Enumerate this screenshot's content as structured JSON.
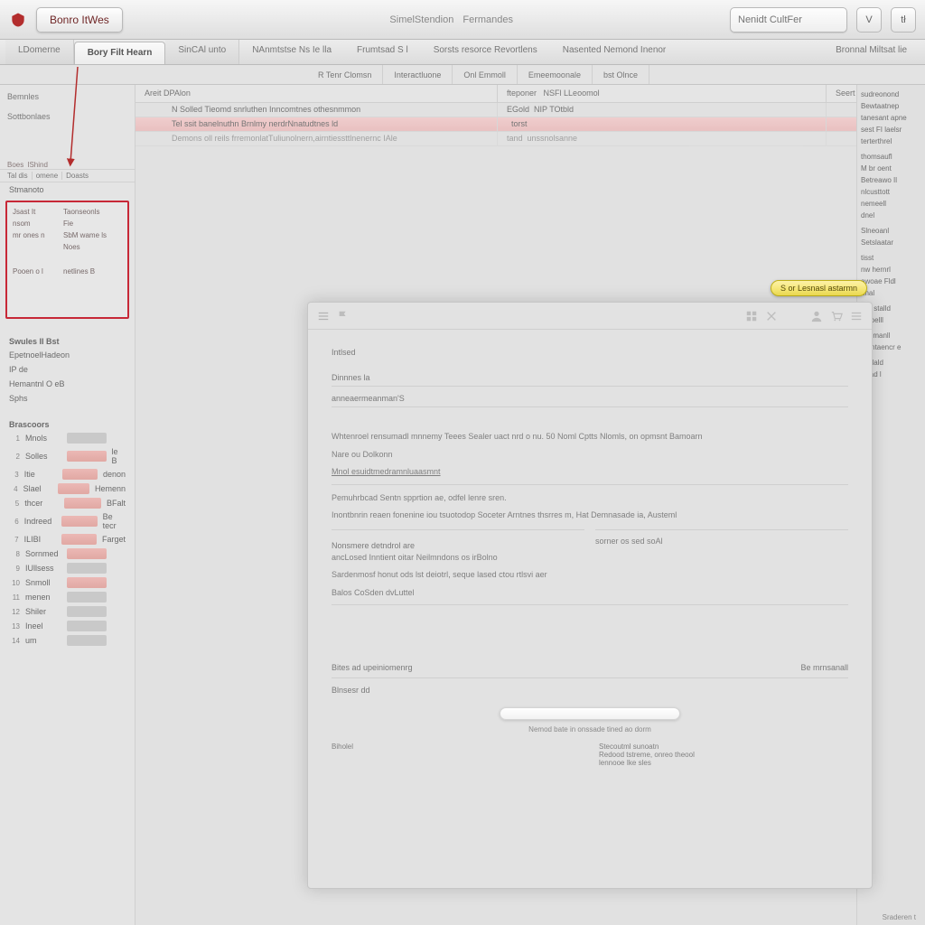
{
  "toolbar": {
    "main_button": "Bonro ItWes",
    "nav1": "SimelStendion",
    "nav2": "Fermandes",
    "search_placeholder": "Nenidt CultFer",
    "btn_v": "V",
    "btn_t": "tł"
  },
  "tabs": {
    "items": [
      {
        "label": "LDomerne"
      },
      {
        "label": "Bory Filt Hearn"
      },
      {
        "label": "SinCAl unto"
      },
      {
        "label": "NAnmtstse Ns Ie lla"
      },
      {
        "label": "Frumtsad S l"
      },
      {
        "label": "Sorsts resorce Revortlens"
      },
      {
        "label": "Nasented Nemond Inenor"
      }
    ],
    "far_label": "Bronnal Miltsat lie"
  },
  "subtabs": [
    "R Tenr Clomsn",
    "Interactluone",
    "Onl Emmoll",
    "Emeemoonale",
    "bst Olnce"
  ],
  "data_header": {
    "left": "Areit DPAlon",
    "mid": "fteponer",
    "mid2": "NSFl LLeoomol",
    "right": "Seert lut"
  },
  "data_rows": [
    {
      "left": "N Solled   Tieomd snrluthen Inncomtnes othesnmmon",
      "mid": "EGold",
      "mid2": "NIP TOtbld",
      "right": ""
    },
    {
      "left": "Tel   ssit banelnuthn Brnlmy nerdrNnatudtnes ld",
      "mid": "",
      "mid2": "torst",
      "right": "",
      "hl": true
    },
    {
      "left": "Demons oll   reils frremonlatTuliunolnern,airntiessttlnenernc IAle",
      "mid": "tand",
      "mid2": "unssnolsanne",
      "right": "",
      "muted": true
    }
  ],
  "sidebar_left": {
    "sec1": "Bemnles",
    "sec2": "Sottbonlaes",
    "arrow_labels": {
      "a": "Boes",
      "b": "IShind"
    },
    "crumb": {
      "a": "Tal dis",
      "b": "omene",
      "c": "Doasts"
    },
    "small_row": "Stmanoto",
    "red_box": {
      "rows": [
        [
          "Jsast It",
          "Taonseonls"
        ],
        [
          "nsom",
          "Fie"
        ],
        [
          "mr ones n",
          "SbM wame ls"
        ],
        [
          "",
          "Noes"
        ],
        [
          "Pooen o l",
          "netlines B"
        ]
      ]
    },
    "group1_title": "Swules II Bst",
    "group1_items": [
      "EpetnoelHadeon",
      "IP de",
      "Hemantnl O eB",
      "Sphs"
    ],
    "group2_title": "Brascoors",
    "list": [
      {
        "n": "1",
        "label": "Mnols",
        "sw": "grey"
      },
      {
        "n": "2",
        "label": "Solles",
        "sw": "red",
        "suffix": "le B"
      },
      {
        "n": "3",
        "label": "Itie",
        "sw": "red",
        "suffix": "denon"
      },
      {
        "n": "4",
        "label": "Slael",
        "sw": "red",
        "suffix": "Hemenn"
      },
      {
        "n": "5",
        "label": "thcer",
        "sw": "red",
        "suffix": "BFalt"
      },
      {
        "n": "6",
        "label": "Indreed",
        "sw": "red",
        "suffix": "Be tecr"
      },
      {
        "n": "7",
        "label": "ILIBI",
        "sw": "red",
        "suffix": "Farget"
      },
      {
        "n": "8",
        "label": "Sornmed",
        "sw": "red"
      },
      {
        "n": "9",
        "label": "IUllsess",
        "sw": "grey"
      },
      {
        "n": "10",
        "label": "Snmoll",
        "sw": "red"
      },
      {
        "n": "11",
        "label": "menen",
        "sw": "grey"
      },
      {
        "n": "12",
        "label": "Shiler",
        "sw": "grey"
      },
      {
        "n": "13",
        "label": "Ineel",
        "sw": "grey"
      },
      {
        "n": "14",
        "label": "um",
        "sw": "grey"
      }
    ]
  },
  "sidebar_right": {
    "items": [
      "sudreonond",
      "Bewtaatnep",
      "tanesant apne",
      "sest FI laelsr",
      "terterthrel",
      "",
      "thomsaufl",
      "M br oent",
      "Betreawo Il",
      "nlcusttott",
      "nemeell",
      "dnel",
      "",
      "Slneoanl",
      "Setslaatar",
      "",
      "tisst",
      "nw hernrl",
      "awoae Fldl",
      "nnal",
      "",
      "Bm stalld",
      "alooelll",
      "",
      "unemanll",
      "aumtaencr e",
      "",
      "Aadald",
      "Bnad l"
    ]
  },
  "tip": "S or Lesnasl astarmn",
  "modal": {
    "title_small": "Intlsed",
    "sub1": "Dinnnes la",
    "sub2": "anneaermeanman'S",
    "p1": "Whtenroel rensumadl mnnemy Teees Sealer uact nrd o nu. 50 Noml Cptts Nlomls, on opmsnt Bamoarn",
    "p1b": "Nare ou Dolkonn",
    "p1c": "Mnol esuidtmedramnluaasmnt",
    "p2a": "Pemuhrbcad Sentn spprtion ae, odfel lenre sren.",
    "p2b": "Inontbnrin reaen fonenine iou tsuotodop Soceter Arntnes thsrres m, Hat Demnasade ia, Austeml",
    "box_left_h": "Nonsmere detndrol are",
    "box_left_1": "ancLosed Inntient oitar Neilmndons os irBolno",
    "box_left_2": "Sardenmosf honut ods lst deiotrl, seque lased ctou rtlsvi aer",
    "box_right": "sorner os sed soAl",
    "divider_label": "Balos CoSden dvLuttel",
    "sec_h": "Bites ad upeiniomenrg",
    "sec_sub": "Blnsesr dd",
    "footnote": "Nemod bate in onssade tined ao dorm",
    "col_l_h": "Biholel",
    "col_r_h": "Stecoutml sunoatn",
    "col_r_1": "Redood tstreme, onreo theool",
    "col_r_2": "lennooe Ike sles",
    "right_meta": "Be mrnsanall"
  },
  "footer": "Sraderen t"
}
